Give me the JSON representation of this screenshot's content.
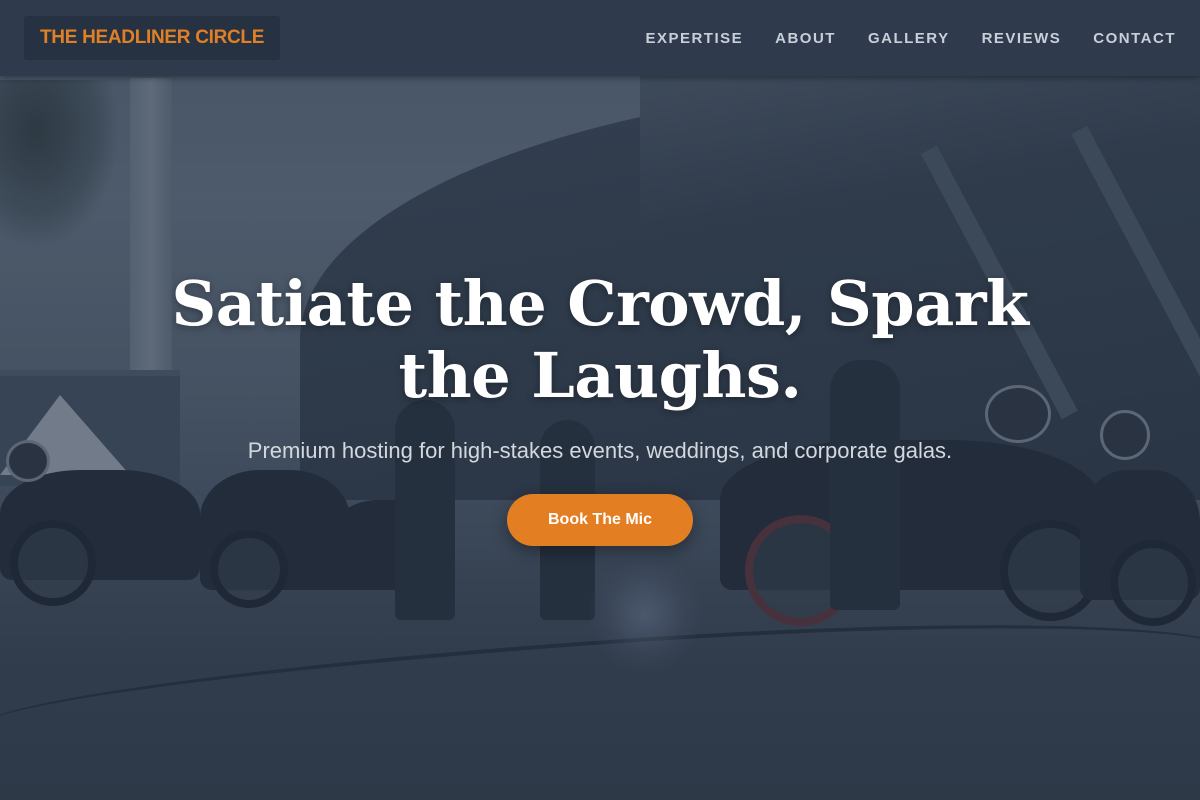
{
  "brand": {
    "name": "THE HEADLINER CIRCLE",
    "accent_color": "#e37f22"
  },
  "nav": {
    "items": [
      {
        "label": "EXPERTISE"
      },
      {
        "label": "ABOUT"
      },
      {
        "label": "GALLERY"
      },
      {
        "label": "REVIEWS"
      },
      {
        "label": "CONTACT"
      }
    ]
  },
  "hero": {
    "title": "Satiate the Crowd, Spark the Laughs.",
    "subtitle": "Premium hosting for high-stakes events, weddings, and corporate galas.",
    "cta_label": "Book The Mic",
    "background": "motorcycles-parked-outside-stadium-photo"
  },
  "colors": {
    "header_bg": "#2f3b4d",
    "nav_text": "#c9cfd8",
    "hero_overlay": "rgba(40, 55, 75, 0.55)",
    "title_text": "#ffffff"
  }
}
